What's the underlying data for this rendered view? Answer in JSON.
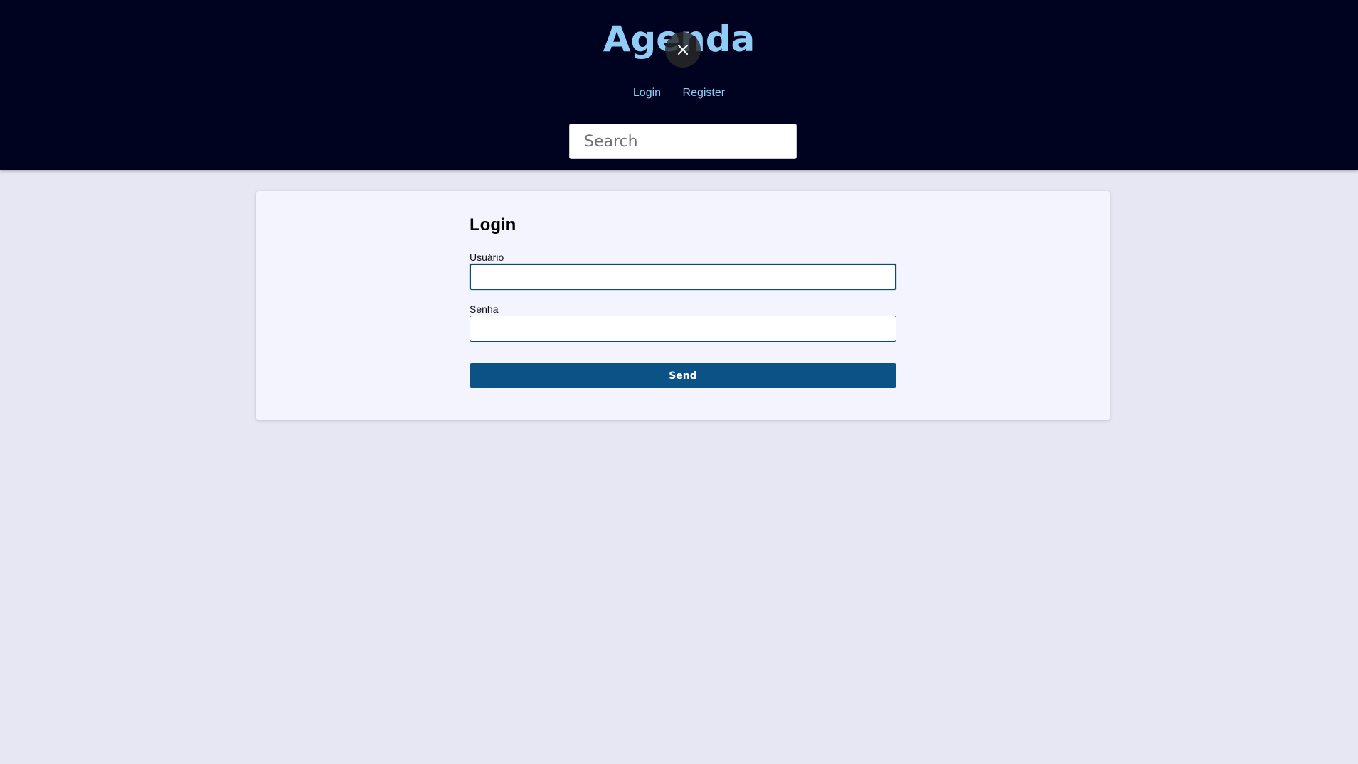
{
  "header": {
    "title": "Agenda",
    "nav": {
      "login_label": "Login",
      "register_label": "Register"
    },
    "search": {
      "placeholder": "Search",
      "value": ""
    }
  },
  "overlay": {
    "close_icon": "close-icon"
  },
  "login_form": {
    "title": "Login",
    "username": {
      "label": "Usuário",
      "value": ""
    },
    "password": {
      "label": "Senha",
      "value": ""
    },
    "send_label": "Send"
  },
  "colors": {
    "header_bg": "#00031f",
    "title": "#8fcdf6",
    "page_bg": "#e7e6f3",
    "card_bg": "#f4f4fe",
    "accent": "#0b5287"
  }
}
